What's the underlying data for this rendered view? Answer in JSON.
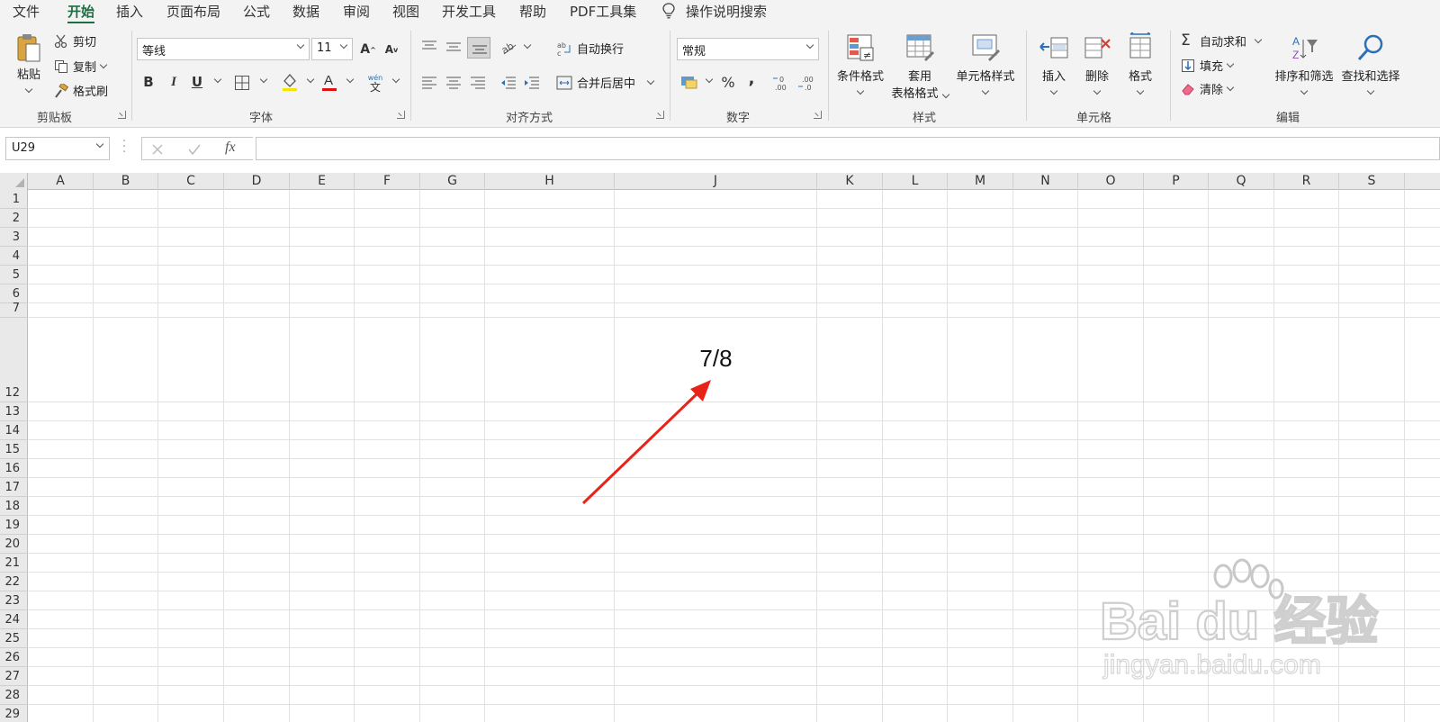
{
  "tabs": [
    "文件",
    "开始",
    "插入",
    "页面布局",
    "公式",
    "数据",
    "审阅",
    "视图",
    "开发工具",
    "帮助",
    "PDF工具集"
  ],
  "active_tab": "开始",
  "tell_me": "操作说明搜索",
  "clipboard": {
    "paste": "粘贴",
    "cut": "剪切",
    "copy": "复制",
    "format_painter": "格式刷",
    "group": "剪贴板"
  },
  "font": {
    "name": "等线",
    "size": "11",
    "group": "字体",
    "bold": "B",
    "italic": "I",
    "underline": "U",
    "grow": "A",
    "shrink": "A",
    "phonetic": "文"
  },
  "alignment": {
    "wrap": "自动换行",
    "merge": "合并后居中",
    "group": "对齐方式"
  },
  "number": {
    "format": "常规",
    "percent": "%",
    "comma": ",",
    "group": "数字"
  },
  "styles": {
    "conditional": "条件格式",
    "table_line1": "套用",
    "table_line2": "表格格式",
    "cell_styles": "单元格样式",
    "group": "样式"
  },
  "cells": {
    "insert": "插入",
    "delete": "删除",
    "format": "格式",
    "group": "单元格"
  },
  "editing": {
    "autosum": "自动求和",
    "fill": "填充",
    "clear": "清除",
    "sort": "排序和筛选",
    "find": "查找和选择",
    "group": "编辑"
  },
  "name_box": "U29",
  "formula_bar": {
    "fx": "fx",
    "value": ""
  },
  "columns": [
    "A",
    "B",
    "C",
    "D",
    "E",
    "F",
    "G",
    "H",
    "J",
    "K",
    "L",
    "M",
    "N",
    "O",
    "P",
    "Q",
    "R",
    "S"
  ],
  "rows": [
    "1",
    "2",
    "3",
    "4",
    "5",
    "6",
    "7",
    "12",
    "13",
    "14",
    "15",
    "16",
    "17",
    "18",
    "19",
    "20",
    "21",
    "22",
    "23",
    "24",
    "25",
    "26",
    "27",
    "28",
    "29"
  ],
  "cell_values": {
    "J12": "7/8"
  },
  "colors": {
    "accent_green": "#1f6e43",
    "arrow_red": "#e8231a",
    "font_color_bar": "#e01010"
  },
  "watermark": {
    "text": "Bai du 经验",
    "sub": "jingyan.baidu.com"
  }
}
